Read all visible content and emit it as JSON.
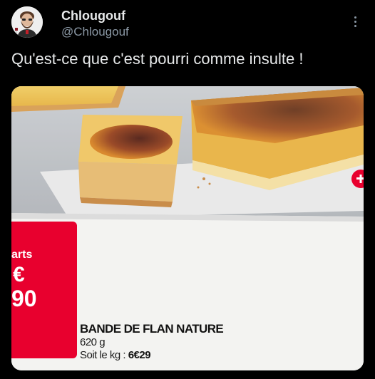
{
  "post": {
    "author_name": "Chlougouf",
    "author_handle": "@Chlougouf",
    "text": "Qu'est-ce que c'est pourri comme insulte !"
  },
  "icons": {
    "avatar": "bearded-man-avatar",
    "more": "more-vertical-icon"
  },
  "ad": {
    "price_suffix": "arts",
    "price_currency": "€",
    "price_cents": "90",
    "product_name": "BANDE DE FLAN NATURE",
    "product_weight": "620 g",
    "price_per_kg_label": "Soit le kg : ",
    "price_per_kg_value": "6€29"
  },
  "colors": {
    "background": "#000000",
    "text_primary": "#e7e9ea",
    "text_secondary": "#8b98a5",
    "price_tag": "#e8002e"
  }
}
